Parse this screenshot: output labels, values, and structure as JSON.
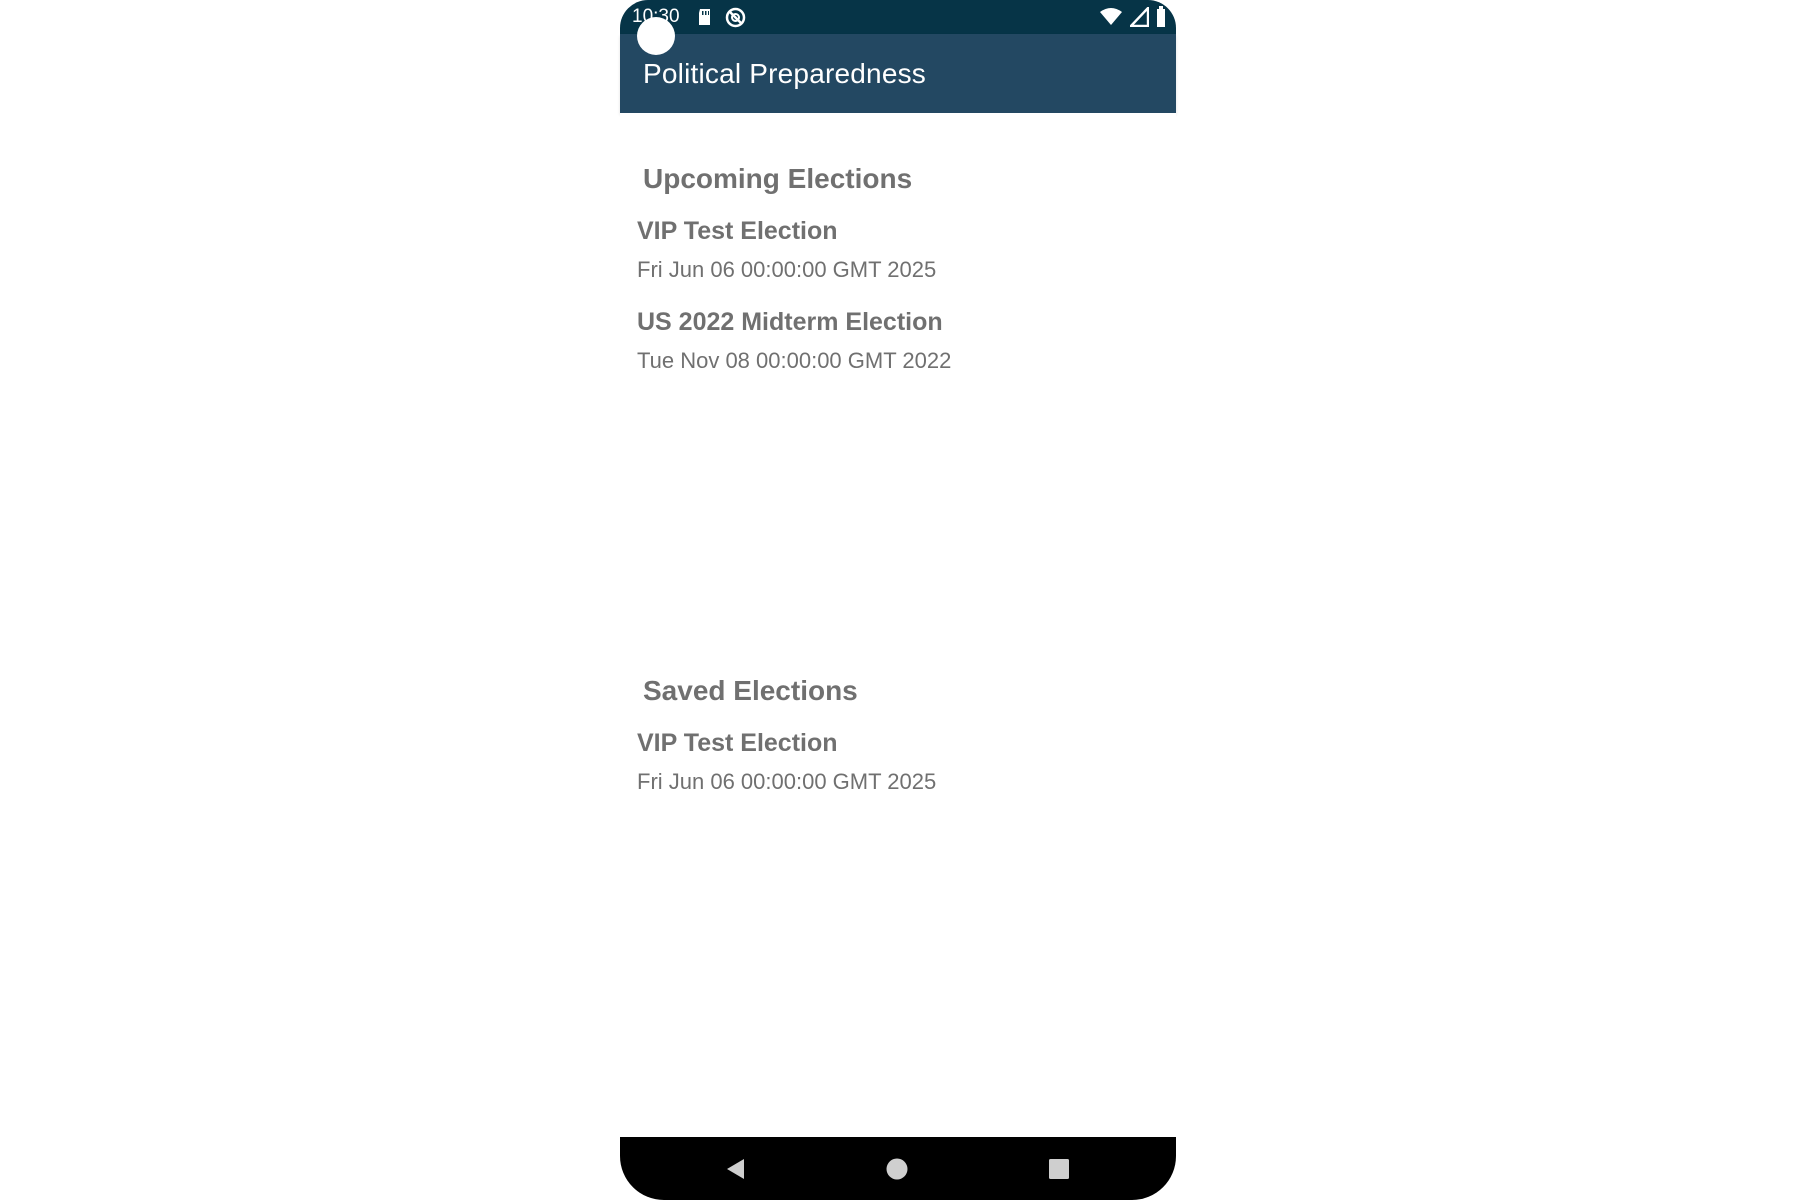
{
  "status_bar": {
    "time": "10:30",
    "left_icons": [
      "sd-card-icon",
      "no-disturb-icon"
    ],
    "right_icons": [
      "wifi-icon",
      "cellular-signal-icon",
      "battery-icon"
    ]
  },
  "app_bar": {
    "title": "Political Preparedness"
  },
  "upcoming": {
    "title": "Upcoming Elections",
    "items": [
      {
        "name": "VIP Test Election",
        "date": "Fri Jun 06 00:00:00 GMT 2025"
      },
      {
        "name": "US 2022 Midterm Election",
        "date": "Tue Nov 08 00:00:00 GMT 2022"
      }
    ]
  },
  "saved": {
    "title": "Saved Elections",
    "items": [
      {
        "name": "VIP Test Election",
        "date": "Fri Jun 06 00:00:00 GMT 2025"
      }
    ]
  },
  "navigation": {
    "buttons": [
      "back-icon",
      "home-icon",
      "recents-icon"
    ]
  },
  "colors": {
    "status_bar": "#063447",
    "app_bar": "#234862",
    "text": "#707070",
    "background": "#ffffff",
    "navigation_bar": "#000000"
  }
}
